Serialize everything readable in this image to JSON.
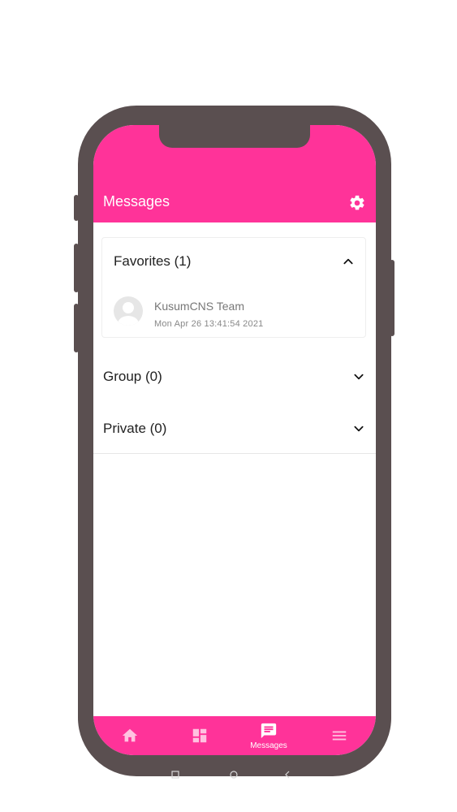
{
  "header": {
    "title": "Messages",
    "settings_icon": "gear-icon"
  },
  "sections": {
    "favorites": {
      "title": "Favorites (1)",
      "expanded": true,
      "items": [
        {
          "name": "KusumCNS Team",
          "date": "Mon Apr 26 13:41:54 2021"
        }
      ]
    },
    "group": {
      "title": "Group (0)",
      "expanded": false
    },
    "private": {
      "title": "Private (0)",
      "expanded": false
    }
  },
  "tabbar": {
    "tabs": [
      {
        "icon": "home-icon",
        "label": ""
      },
      {
        "icon": "dashboard-icon",
        "label": ""
      },
      {
        "icon": "messages-icon",
        "label": "Messages",
        "active": true
      },
      {
        "icon": "menu-icon",
        "label": ""
      }
    ]
  },
  "colors": {
    "accent": "#ff3399",
    "phone_frame": "#5a4f50"
  }
}
